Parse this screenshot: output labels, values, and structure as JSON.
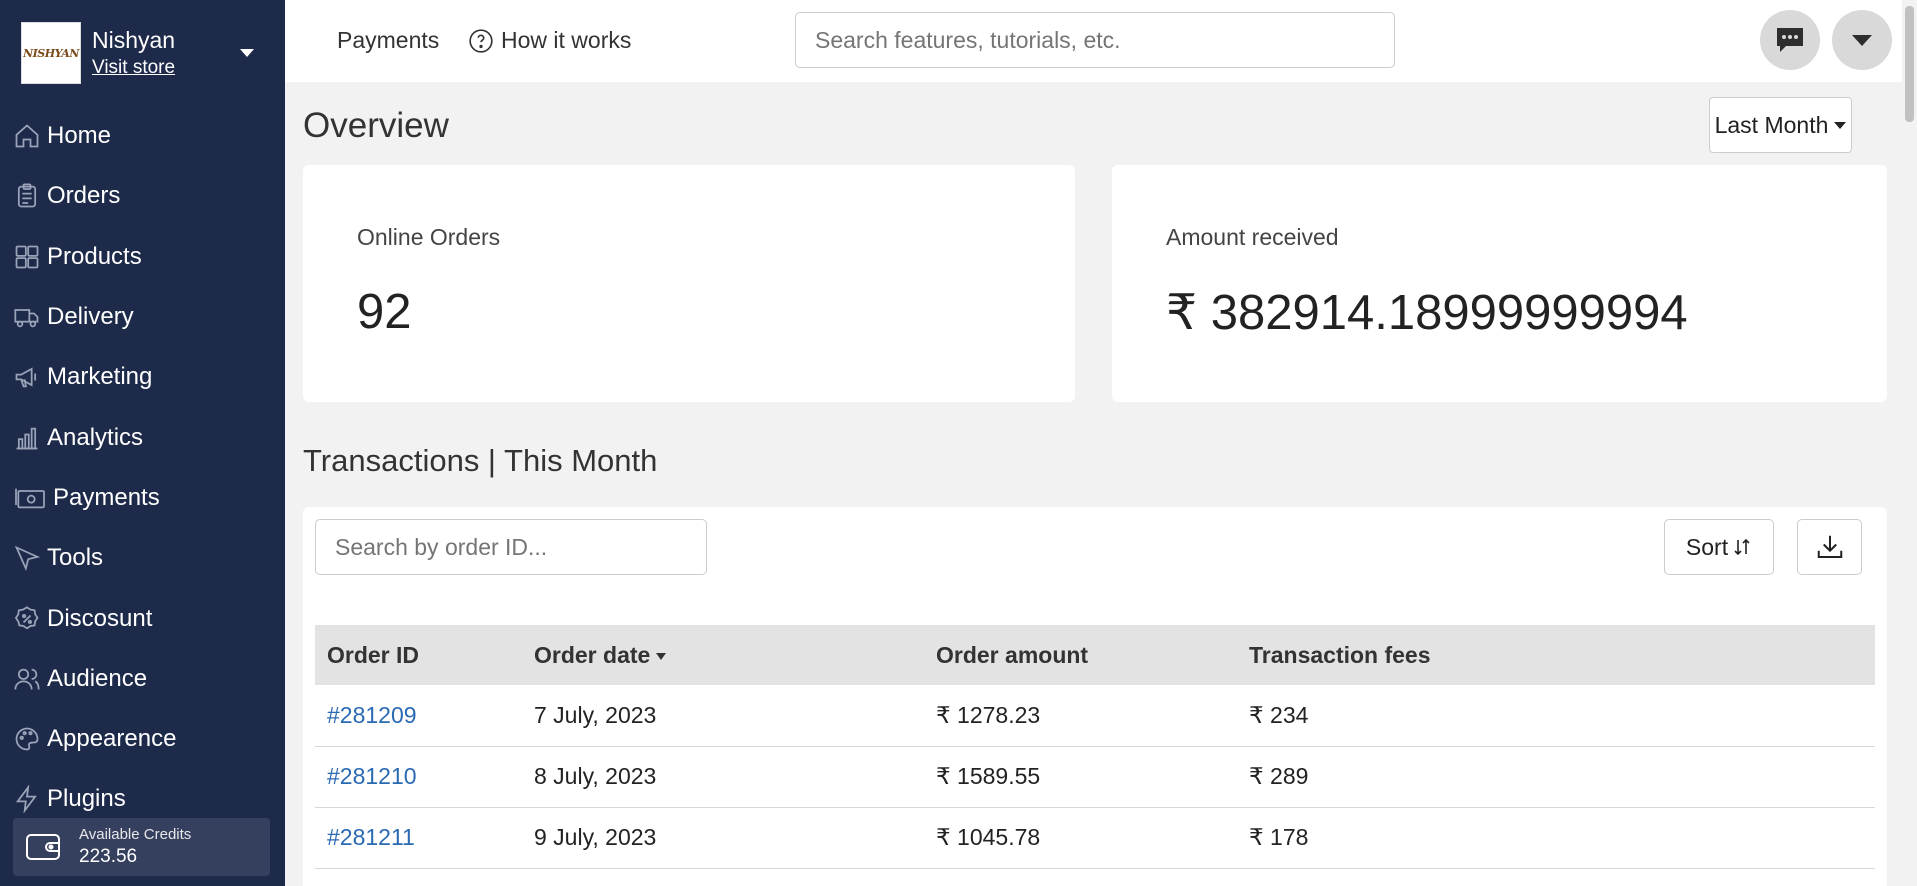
{
  "store": {
    "name": "Nishyan",
    "visit_label": "Visit store",
    "logo_text": "NISHYAN"
  },
  "nav": [
    {
      "label": "Home",
      "icon": "home-icon"
    },
    {
      "label": "Orders",
      "icon": "clipboard-icon"
    },
    {
      "label": "Products",
      "icon": "grid-icon"
    },
    {
      "label": "Delivery",
      "icon": "truck-icon"
    },
    {
      "label": "Marketing",
      "icon": "megaphone-icon"
    },
    {
      "label": "Analytics",
      "icon": "bar-chart-icon"
    },
    {
      "label": "Payments",
      "icon": "cash-icon"
    },
    {
      "label": "Tools",
      "icon": "cursor-icon"
    },
    {
      "label": "Discosunt",
      "icon": "percent-badge-icon"
    },
    {
      "label": "Audience",
      "icon": "people-icon"
    },
    {
      "label": "Appearence",
      "icon": "palette-icon"
    },
    {
      "label": "Plugins",
      "icon": "lightning-icon"
    }
  ],
  "credits": {
    "label": "Available Credits",
    "value": "223.56"
  },
  "topbar": {
    "payments_label": "Payments",
    "how_label": "How it works",
    "search_placeholder": "Search features, tutorials, etc."
  },
  "overview": {
    "title": "Overview",
    "period": "Last Month",
    "online_orders_label": "Online Orders",
    "online_orders_value": "92",
    "amount_label": "Amount received",
    "amount_value": "₹ 382914.18999999994"
  },
  "transactions": {
    "title": "Transactions | This Month",
    "search_placeholder": "Search by order ID...",
    "sort_label": "Sort",
    "columns": [
      "Order ID",
      "Order date",
      "Order amount",
      "Transaction fees"
    ],
    "rows": [
      {
        "id": "#281209",
        "date": "7 July, 2023",
        "amount": "₹ 1278.23",
        "fees": "₹ 234"
      },
      {
        "id": "#281210",
        "date": "8 July, 2023",
        "amount": "₹ 1589.55",
        "fees": "₹ 289"
      },
      {
        "id": "#281211",
        "date": "9 July, 2023",
        "amount": "₹ 1045.78",
        "fees": "₹ 178"
      }
    ]
  },
  "colors": {
    "sidebar": "#1d2a4a",
    "link": "#2a6ab3",
    "background": "#f2f2f2"
  }
}
